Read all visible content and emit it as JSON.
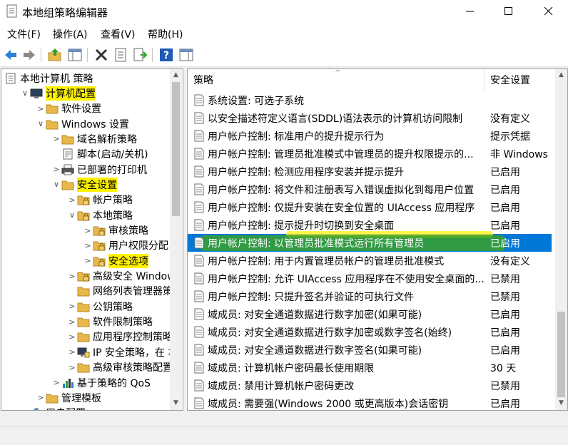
{
  "window": {
    "title": "本地组策略编辑器"
  },
  "menu": [
    "文件(F)",
    "操作(A)",
    "查看(V)",
    "帮助(H)"
  ],
  "toolbar": {
    "buttons": [
      "back-arrow-icon",
      "forward-arrow-icon",
      "up-folder-icon",
      "show-hide-tree-icon",
      "delete-icon",
      "properties-icon",
      "export-list-icon",
      "help-icon",
      "view-icon"
    ]
  },
  "colors": {
    "selection": "#0078d7",
    "highlight_yellow": "#fff200",
    "highlight_green": "#3aa02a",
    "folder": "#e8b84a"
  },
  "tree": [
    {
      "label": "本地计算机 策略",
      "indent": 0,
      "arrow": "",
      "icon": "policy-icon",
      "highlight": false
    },
    {
      "label": "计算机配置",
      "indent": 1,
      "arrow": "∨",
      "icon": "computer-icon",
      "highlight": true
    },
    {
      "label": "软件设置",
      "indent": 2,
      "arrow": ">",
      "icon": "folder-icon",
      "highlight": false
    },
    {
      "label": "Windows 设置",
      "indent": 2,
      "arrow": "∨",
      "icon": "folder-icon",
      "highlight": false
    },
    {
      "label": "域名解析策略",
      "indent": 3,
      "arrow": ">",
      "icon": "folder-icon",
      "highlight": false
    },
    {
      "label": "脚本(启动/关机)",
      "indent": 3,
      "arrow": "",
      "icon": "script-icon",
      "highlight": false
    },
    {
      "label": "已部署的打印机",
      "indent": 3,
      "arrow": ">",
      "icon": "printer-icon",
      "highlight": false
    },
    {
      "label": "安全设置",
      "indent": 3,
      "arrow": "∨",
      "icon": "folder-icon",
      "highlight": true
    },
    {
      "label": "帐户策略",
      "indent": 4,
      "arrow": ">",
      "icon": "lock-folder-icon",
      "highlight": false
    },
    {
      "label": "本地策略",
      "indent": 4,
      "arrow": "∨",
      "icon": "lock-folder-icon",
      "highlight": false
    },
    {
      "label": "审核策略",
      "indent": 5,
      "arrow": ">",
      "icon": "lock-folder-icon",
      "highlight": false
    },
    {
      "label": "用户权限分配",
      "indent": 5,
      "arrow": ">",
      "icon": "lock-folder-icon",
      "highlight": false
    },
    {
      "label": "安全选项",
      "indent": 5,
      "arrow": ">",
      "icon": "lock-folder-icon",
      "highlight": true
    },
    {
      "label": "高级安全 Windows",
      "indent": 4,
      "arrow": ">",
      "icon": "lock-folder-icon",
      "highlight": false
    },
    {
      "label": "网络列表管理器策",
      "indent": 4,
      "arrow": "",
      "icon": "folder-icon",
      "highlight": false
    },
    {
      "label": "公钥策略",
      "indent": 4,
      "arrow": ">",
      "icon": "folder-icon",
      "highlight": false
    },
    {
      "label": "软件限制策略",
      "indent": 4,
      "arrow": ">",
      "icon": "folder-icon",
      "highlight": false
    },
    {
      "label": "应用程序控制策略",
      "indent": 4,
      "arrow": ">",
      "icon": "folder-icon",
      "highlight": false
    },
    {
      "label": "IP 安全策略，在 本",
      "indent": 4,
      "arrow": ">",
      "icon": "ip-security-icon",
      "highlight": false
    },
    {
      "label": "高级审核策略配置",
      "indent": 4,
      "arrow": ">",
      "icon": "folder-icon",
      "highlight": false
    },
    {
      "label": "基于策略的 QoS",
      "indent": 3,
      "arrow": ">",
      "icon": "qos-chart-icon",
      "highlight": false
    },
    {
      "label": "管理模板",
      "indent": 2,
      "arrow": ">",
      "icon": "folder-icon",
      "highlight": false
    },
    {
      "label": "用户配置",
      "indent": 1,
      "arrow": "",
      "icon": "user-icon",
      "highlight": false
    }
  ],
  "list": {
    "columns": {
      "policy": "策略",
      "setting": "安全设置"
    },
    "rows": [
      {
        "policy": "系统设置: 可选子系统",
        "setting": ""
      },
      {
        "policy": "以安全描述符定义语言(SDDL)语法表示的计算机访问限制",
        "setting": "没有定义"
      },
      {
        "policy": "用户帐户控制: 标准用户的提升提示行为",
        "setting": "提示凭据"
      },
      {
        "policy": "用户帐户控制: 管理员批准模式中管理员的提升权限提示的...",
        "setting": "非 Windows 二"
      },
      {
        "policy": "用户帐户控制: 检测应用程序安装并提示提升",
        "setting": "已启用"
      },
      {
        "policy": "用户帐户控制: 将文件和注册表写入错误虚拟化到每用户位置",
        "setting": "已启用"
      },
      {
        "policy": "用户帐户控制: 仅提升安装在安全位置的 UIAccess 应用程序",
        "setting": "已启用"
      },
      {
        "policy": "用户帐户控制: 提示提升时切换到安全桌面",
        "setting": "已启用"
      },
      {
        "policy": "用户帐户控制: 以管理员批准模式运行所有管理员",
        "setting": "已启用",
        "selected": true
      },
      {
        "policy": "用户帐户控制: 用于内置管理员帐户的管理员批准模式",
        "setting": "没有定义"
      },
      {
        "policy": "用户帐户控制: 允许 UIAccess 应用程序在不使用安全桌面的...",
        "setting": "已禁用"
      },
      {
        "policy": "用户帐户控制: 只提升签名并验证的可执行文件",
        "setting": "已禁用"
      },
      {
        "policy": "域成员: 对安全通道数据进行数字加密(如果可能)",
        "setting": "已启用"
      },
      {
        "policy": "域成员: 对安全通道数据进行数字加密或数字签名(始终)",
        "setting": "已启用"
      },
      {
        "policy": "域成员: 对安全通道数据进行数字签名(如果可能)",
        "setting": "已启用"
      },
      {
        "policy": "域成员: 计算机帐户密码最长使用期限",
        "setting": "30 天"
      },
      {
        "policy": "域成员: 禁用计算机帐户密码更改",
        "setting": "已禁用"
      },
      {
        "policy": "域成员: 需要强(Windows 2000 或更高版本)会话密钥",
        "setting": "已启用"
      }
    ]
  }
}
